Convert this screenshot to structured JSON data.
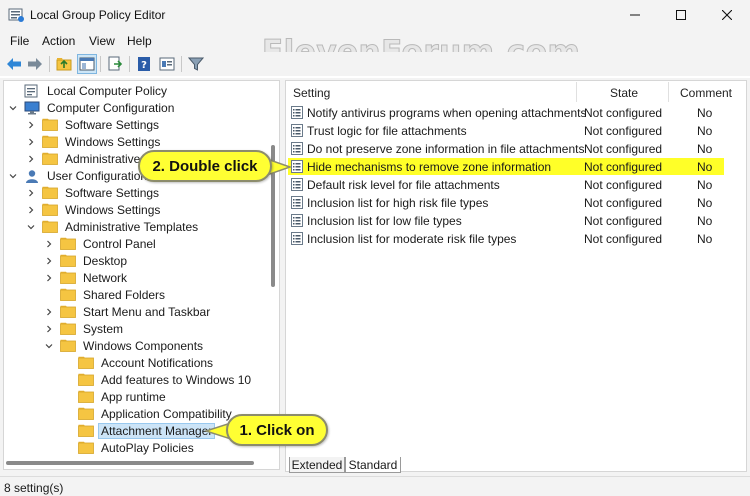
{
  "window": {
    "title": "Local Group Policy Editor",
    "controls": {
      "minimize": "minimize-icon",
      "maximize": "maximize-icon",
      "close": "close-icon"
    }
  },
  "menu": {
    "items": [
      "File",
      "Action",
      "View",
      "Help"
    ]
  },
  "watermark": "ElevenForum.com",
  "toolbar": {
    "icons": [
      "back-arrow-icon",
      "forward-arrow-icon",
      "up-folder-icon",
      "show-hide-tree-icon",
      "export-list-icon",
      "help-icon",
      "properties-icon",
      "filter-icon"
    ]
  },
  "tree": {
    "root": "Local Computer Policy",
    "computer_configuration": "Computer Configuration",
    "software_settings_1": "Software Settings",
    "windows_settings_1": "Windows Settings",
    "administrative_templates_1": "Administrative T",
    "user_configuration": "User Configuration",
    "software_settings_2": "Software Settings",
    "windows_settings_2": "Windows Settings",
    "administrative_templates_2": "Administrative Templates",
    "control_panel": "Control Panel",
    "desktop": "Desktop",
    "network": "Network",
    "shared_folders": "Shared Folders",
    "start_menu": "Start Menu and Taskbar",
    "system": "System",
    "windows_components": "Windows Components",
    "account_notifications": "Account Notifications",
    "add_features": "Add features to Windows 10",
    "app_runtime": "App runtime",
    "app_compat": "Application Compatibility",
    "attachment_manager": "Attachment Manager",
    "autoplay": "AutoPlay Policies"
  },
  "list": {
    "headers": {
      "setting": "Setting",
      "state": "State",
      "comment": "Comment"
    },
    "rows": [
      {
        "name": "Notify antivirus programs when opening attachments",
        "state": "Not configured",
        "comment": "No"
      },
      {
        "name": "Trust logic for file attachments",
        "state": "Not configured",
        "comment": "No"
      },
      {
        "name": "Do not preserve zone information in file attachments",
        "state": "Not configured",
        "comment": "No"
      },
      {
        "name": "Hide mechanisms to remove zone information",
        "state": "Not configured",
        "comment": "No"
      },
      {
        "name": "Default risk level for file attachments",
        "state": "Not configured",
        "comment": "No"
      },
      {
        "name": "Inclusion list for high risk file types",
        "state": "Not configured",
        "comment": "No"
      },
      {
        "name": "Inclusion list for low file types",
        "state": "Not configured",
        "comment": "No"
      },
      {
        "name": "Inclusion list for moderate risk file types",
        "state": "Not configured",
        "comment": "No"
      }
    ]
  },
  "tabs": {
    "extended": "Extended",
    "standard": "Standard"
  },
  "status": "8 setting(s)",
  "callouts": {
    "double_click": "2. Double click",
    "click_on": "1. Click on"
  },
  "colors": {
    "highlight": "#ffff28",
    "callout": "#ffff33",
    "selection": "#cce4f7",
    "folder": "#f5c542"
  }
}
